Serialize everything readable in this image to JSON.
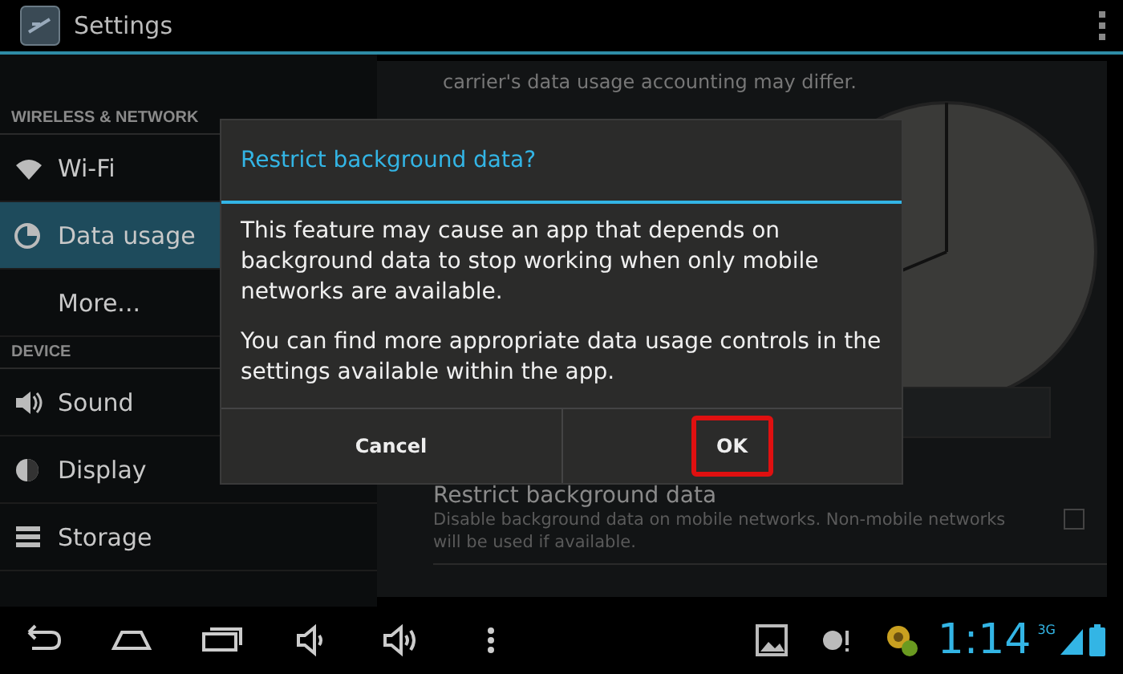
{
  "action_bar": {
    "title": "Settings"
  },
  "sidebar": {
    "sections": [
      {
        "header": "WIRELESS & NETWORK",
        "items": [
          {
            "label": "Wi-Fi",
            "selected": false
          },
          {
            "label": "Data usage",
            "selected": true
          },
          {
            "label": "More...",
            "selected": false
          }
        ]
      },
      {
        "header": "DEVICE",
        "items": [
          {
            "label": "Sound",
            "selected": false
          },
          {
            "label": "Display",
            "selected": false
          },
          {
            "label": "Storage",
            "selected": false
          }
        ]
      }
    ]
  },
  "content": {
    "note": "carrier's data usage accounting may differ.",
    "setting": {
      "title": "Restrict background data",
      "summary": "Disable background data on mobile networks. Non-mobile networks will be used if available.",
      "checked": false
    }
  },
  "dialog": {
    "title": "Restrict background data?",
    "paragraphs": [
      "This feature may cause an app that depends on background data to stop working when only mobile networks are available.",
      "You can find more appropriate data usage controls in the settings available within the app."
    ],
    "buttons": [
      {
        "label": "Cancel",
        "highlighted": false
      },
      {
        "label": "OK",
        "highlighted": true
      }
    ]
  },
  "system_bar": {
    "time": "1:14",
    "network": "3G"
  }
}
